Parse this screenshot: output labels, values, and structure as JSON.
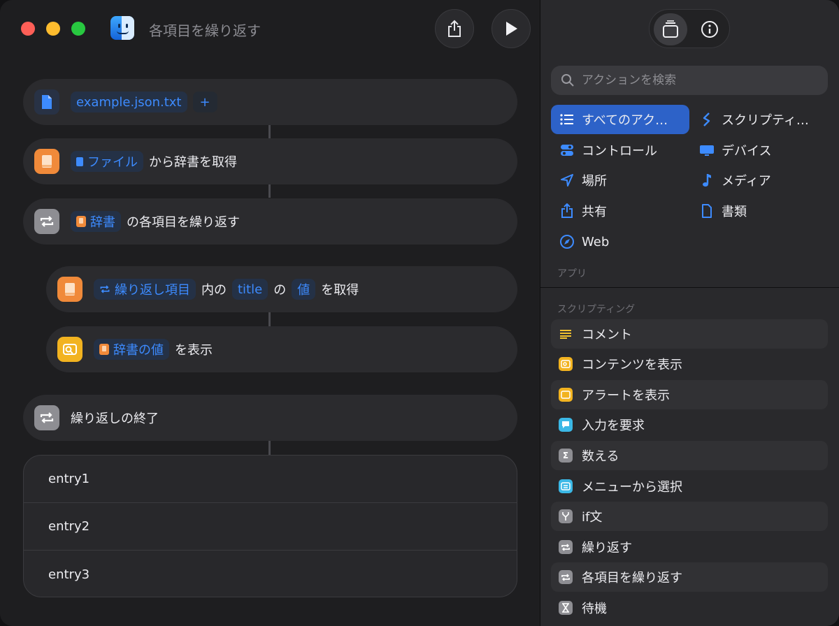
{
  "window": {
    "title": "各項目を繰り返す"
  },
  "toolbar": {
    "share_icon": "share-icon",
    "run_icon": "play-icon"
  },
  "workflow": {
    "file_row": {
      "filename": "example.json.txt",
      "add_symbol": "+"
    },
    "get_dict_row": {
      "param": "ファイル",
      "text": "から辞書を取得"
    },
    "repeat_row": {
      "param": "辞書",
      "text": "の各項目を繰り返す"
    },
    "get_value_row": {
      "param1": "繰り返し項目",
      "text1": "内の",
      "param2": "title",
      "text2": "の",
      "param3": "値",
      "text3": "を取得"
    },
    "show_row": {
      "param": "辞書の値",
      "text": "を表示"
    },
    "end_repeat_row": {
      "text": "繰り返しの終了"
    },
    "result": {
      "entries": [
        "entry1",
        "entry2",
        "entry3"
      ]
    }
  },
  "sidebar": {
    "search_placeholder": "アクションを検索",
    "categories": [
      {
        "label": "すべてのアク…",
        "icon": "list-icon",
        "selected": true
      },
      {
        "label": "スクリプティ…",
        "icon": "script-icon"
      },
      {
        "label": "コントロール",
        "icon": "toggle-icon"
      },
      {
        "label": "デバイス",
        "icon": "display-icon"
      },
      {
        "label": "場所",
        "icon": "location-arrow-icon"
      },
      {
        "label": "メディア",
        "icon": "music-note-icon"
      },
      {
        "label": "共有",
        "icon": "share-icon"
      },
      {
        "label": "書類",
        "icon": "document-icon"
      },
      {
        "label": "Web",
        "icon": "compass-icon"
      }
    ],
    "apps_label": "アプリ",
    "scripting_label": "スクリプティング",
    "actions": [
      {
        "label": "コメント",
        "icon": "comment-lines-icon",
        "color": "#f2c230"
      },
      {
        "label": "コンテンツを表示",
        "icon": "quick-look-icon",
        "color": "#f2b320"
      },
      {
        "label": "アラートを表示",
        "icon": "alert-icon",
        "color": "#f2b320"
      },
      {
        "label": "入力を要求",
        "icon": "speech-bubble-icon",
        "color": "#3bb8e6"
      },
      {
        "label": "数える",
        "icon": "sigma-icon",
        "color": "#8e8e93"
      },
      {
        "label": "メニューから選択",
        "icon": "menu-icon",
        "color": "#3bb8e6"
      },
      {
        "label": "if文",
        "icon": "branch-icon",
        "color": "#8e8e93"
      },
      {
        "label": "繰り返す",
        "icon": "repeat-icon",
        "color": "#8e8e93"
      },
      {
        "label": "各項目を繰り返す",
        "icon": "repeat-icon",
        "color": "#8e8e93"
      },
      {
        "label": "待機",
        "icon": "hourglass-icon",
        "color": "#8e8e93"
      }
    ]
  },
  "colors": {
    "accent": "#2d62c8",
    "param_blue": "#3d8bff",
    "orange": "#f08a3a",
    "yellow": "#f2b320"
  }
}
